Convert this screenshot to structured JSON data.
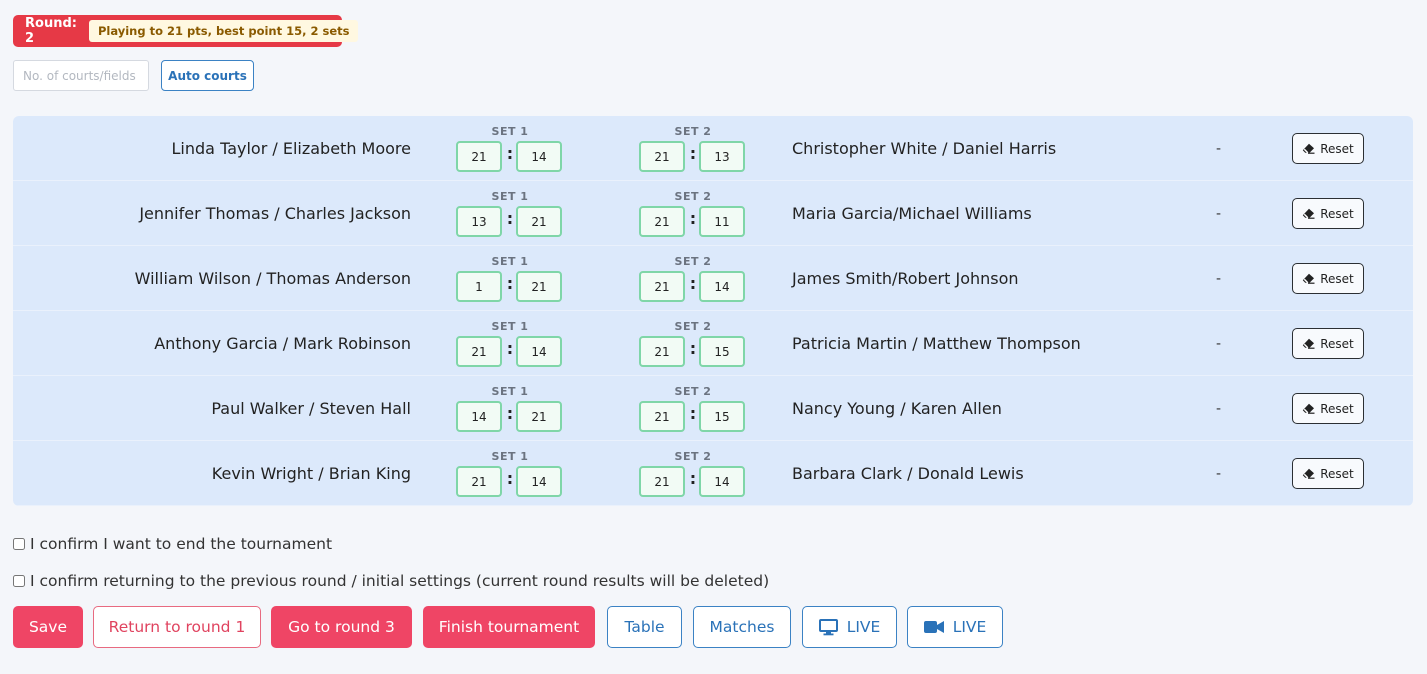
{
  "header": {
    "round_label": "Round: 2",
    "round_info": "Playing to 21 pts, best point 15, 2 sets"
  },
  "courts": {
    "placeholder": "No. of courts/fields",
    "value": "",
    "auto_label": "Auto courts"
  },
  "set_labels": [
    "SET 1",
    "SET 2"
  ],
  "matches": [
    {
      "team_a": "Linda Taylor / Elizabeth Moore",
      "team_b": "Christopher White / Daniel Harris",
      "set1": [
        "21",
        "14"
      ],
      "set2": [
        "21",
        "13"
      ],
      "result": "-",
      "reset_label": "Reset"
    },
    {
      "team_a": "Jennifer Thomas / Charles Jackson",
      "team_b": "Maria Garcia/Michael Williams",
      "set1": [
        "13",
        "21"
      ],
      "set2": [
        "21",
        "11"
      ],
      "result": "-",
      "reset_label": "Reset"
    },
    {
      "team_a": "William Wilson / Thomas Anderson",
      "team_b": "James Smith/Robert Johnson",
      "set1": [
        "1",
        "21"
      ],
      "set2": [
        "21",
        "14"
      ],
      "result": "-",
      "reset_label": "Reset"
    },
    {
      "team_a": "Anthony Garcia / Mark Robinson",
      "team_b": "Patricia Martin / Matthew Thompson",
      "set1": [
        "21",
        "14"
      ],
      "set2": [
        "21",
        "15"
      ],
      "result": "-",
      "reset_label": "Reset"
    },
    {
      "team_a": "Paul Walker / Steven Hall",
      "team_b": "Nancy Young / Karen Allen",
      "set1": [
        "14",
        "21"
      ],
      "set2": [
        "21",
        "15"
      ],
      "result": "-",
      "reset_label": "Reset"
    },
    {
      "team_a": "Kevin Wright / Brian King",
      "team_b": "Barbara Clark / Donald Lewis",
      "set1": [
        "21",
        "14"
      ],
      "set2": [
        "21",
        "14"
      ],
      "result": "-",
      "reset_label": "Reset"
    }
  ],
  "confirm": {
    "end_label": "I confirm I want to end the tournament",
    "end_checked": false,
    "return_label": "I confirm returning to the previous round / initial settings (current round results will be deleted)",
    "return_checked": false
  },
  "buttons": {
    "save": "Save",
    "return": "Return to round 1",
    "next": "Go to round 3",
    "finish": "Finish tournament",
    "table": "Table",
    "matches": "Matches",
    "live_screen": "LIVE",
    "live_video": "LIVE"
  },
  "icons": {
    "reset": "eraser-icon",
    "live_screen": "monitor-icon",
    "live_video": "video-camera-icon"
  },
  "colors": {
    "danger": "#ef4565",
    "badge": "#e63946",
    "primary": "#2a72b8",
    "score_border": "#7fd6a8",
    "match_bg": "#dce9fb"
  }
}
